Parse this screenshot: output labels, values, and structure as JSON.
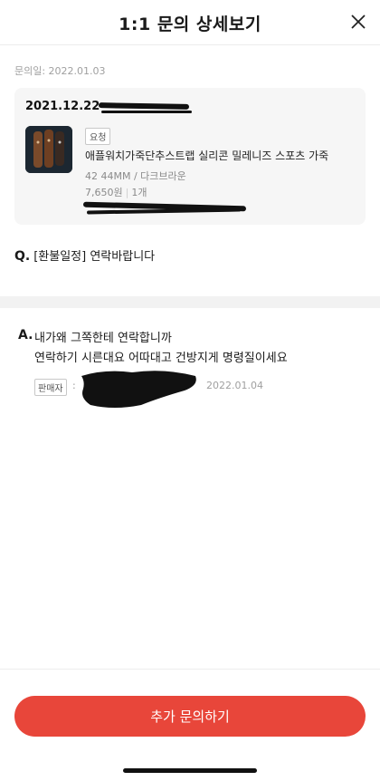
{
  "header": {
    "title": "1:1 문의 상세보기",
    "close_icon": "close-icon"
  },
  "inquiry": {
    "date_label": "문의일: 2022.01.03"
  },
  "order": {
    "date": "2021.12.22",
    "badge": "요청",
    "product_name": "애플워치가죽단추스트랩 실리콘 밀레니즈 스포츠 가죽",
    "option": "42 44MM / 다크브라운",
    "price": "7,650원",
    "quantity": "1개"
  },
  "question": {
    "mark": "Q.",
    "text": "[환불일정] 연락바랍니다"
  },
  "answer": {
    "mark": "A.",
    "line1": "내가왜 그쪽한테 연락합니까",
    "line2": "연락하기 시른대요 어따대고 건방지게 명령질이세요",
    "seller_badge": "판매자",
    "colon": ":",
    "date": "2022.01.04"
  },
  "footer": {
    "button_label": "추가 문의하기"
  },
  "colors": {
    "accent": "#e8463a",
    "card_bg": "#f6f6f6",
    "divider": "#f2f2f2"
  }
}
